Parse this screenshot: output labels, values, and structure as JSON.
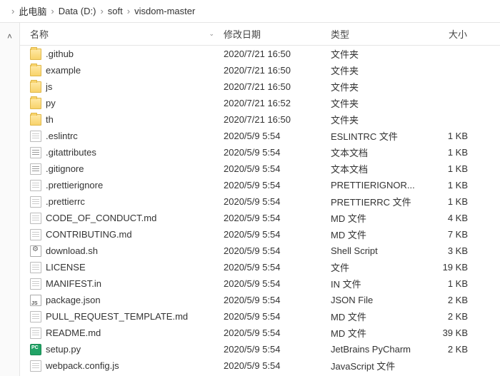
{
  "breadcrumb": {
    "items": [
      "此电脑",
      "Data (D:)",
      "soft",
      "visdom-master"
    ]
  },
  "columns": {
    "name": "名称",
    "date": "修改日期",
    "type": "类型",
    "size": "大小"
  },
  "files": [
    {
      "icon": "folder",
      "name": ".github",
      "date": "2020/7/21 16:50",
      "type": "文件夹",
      "size": ""
    },
    {
      "icon": "folder",
      "name": "example",
      "date": "2020/7/21 16:50",
      "type": "文件夹",
      "size": ""
    },
    {
      "icon": "folder",
      "name": "js",
      "date": "2020/7/21 16:50",
      "type": "文件夹",
      "size": ""
    },
    {
      "icon": "folder",
      "name": "py",
      "date": "2020/7/21 16:52",
      "type": "文件夹",
      "size": ""
    },
    {
      "icon": "folder",
      "name": "th",
      "date": "2020/7/21 16:50",
      "type": "文件夹",
      "size": ""
    },
    {
      "icon": "file",
      "name": ".eslintrc",
      "date": "2020/5/9 5:54",
      "type": "ESLINTRC 文件",
      "size": "1 KB"
    },
    {
      "icon": "text",
      "name": ".gitattributes",
      "date": "2020/5/9 5:54",
      "type": "文本文档",
      "size": "1 KB"
    },
    {
      "icon": "text",
      "name": ".gitignore",
      "date": "2020/5/9 5:54",
      "type": "文本文档",
      "size": "1 KB"
    },
    {
      "icon": "file",
      "name": ".prettierignore",
      "date": "2020/5/9 5:54",
      "type": "PRETTIERIGNOR...",
      "size": "1 KB"
    },
    {
      "icon": "file",
      "name": ".prettierrc",
      "date": "2020/5/9 5:54",
      "type": "PRETTIERRC 文件",
      "size": "1 KB"
    },
    {
      "icon": "file",
      "name": "CODE_OF_CONDUCT.md",
      "date": "2020/5/9 5:54",
      "type": "MD 文件",
      "size": "4 KB"
    },
    {
      "icon": "file",
      "name": "CONTRIBUTING.md",
      "date": "2020/5/9 5:54",
      "type": "MD 文件",
      "size": "7 KB"
    },
    {
      "icon": "sh",
      "name": "download.sh",
      "date": "2020/5/9 5:54",
      "type": "Shell Script",
      "size": "3 KB"
    },
    {
      "icon": "file",
      "name": "LICENSE",
      "date": "2020/5/9 5:54",
      "type": "文件",
      "size": "19 KB"
    },
    {
      "icon": "file",
      "name": "MANIFEST.in",
      "date": "2020/5/9 5:54",
      "type": "IN 文件",
      "size": "1 KB"
    },
    {
      "icon": "json",
      "name": "package.json",
      "date": "2020/5/9 5:54",
      "type": "JSON File",
      "size": "2 KB"
    },
    {
      "icon": "file",
      "name": "PULL_REQUEST_TEMPLATE.md",
      "date": "2020/5/9 5:54",
      "type": "MD 文件",
      "size": "2 KB"
    },
    {
      "icon": "file",
      "name": "README.md",
      "date": "2020/5/9 5:54",
      "type": "MD 文件",
      "size": "39 KB"
    },
    {
      "icon": "py",
      "name": "setup.py",
      "date": "2020/5/9 5:54",
      "type": "JetBrains PyCharm",
      "size": "2 KB"
    },
    {
      "icon": "file",
      "name": "webpack.config.js",
      "date": "2020/5/9 5:54",
      "type": "JavaScript 文件",
      "size": ""
    }
  ]
}
